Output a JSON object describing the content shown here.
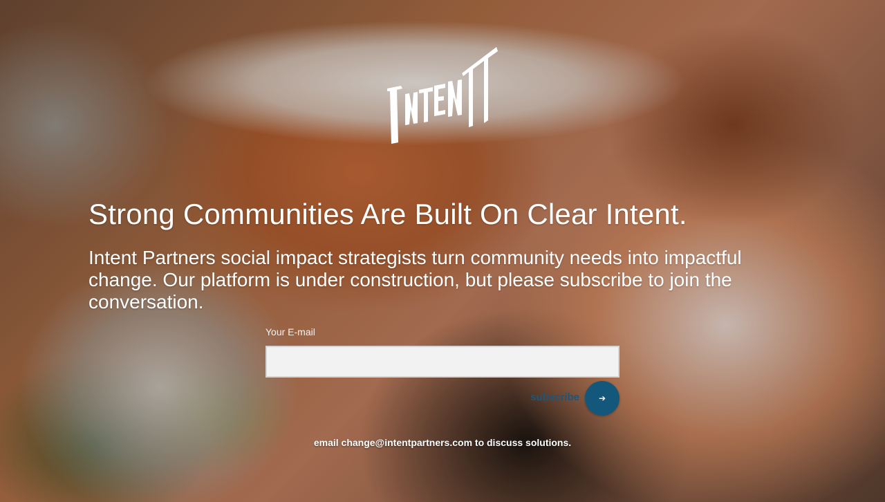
{
  "logo": {
    "text": "INTENT",
    "icon": "intent-logo"
  },
  "hero": {
    "headline": "Strong Communities Are Built On Clear Intent.",
    "description": "Intent Partners social impact strategists turn community needs into impactful change. Our platform is under construction, but please subscribe to join the conversation."
  },
  "form": {
    "email_label": "Your E-mail",
    "email_value": "",
    "email_placeholder": "",
    "subscribe_label": "subscribe",
    "subscribe_icon": "arrow-right-icon",
    "subscribe_glyph": "➔"
  },
  "footer": {
    "prefix": "email",
    "email": "change@intentpartners.com",
    "suffix": "to discuss solutions."
  },
  "colors": {
    "accent": "#13587b",
    "text": "#ffffff",
    "input_bg": "#f1f2f1"
  }
}
